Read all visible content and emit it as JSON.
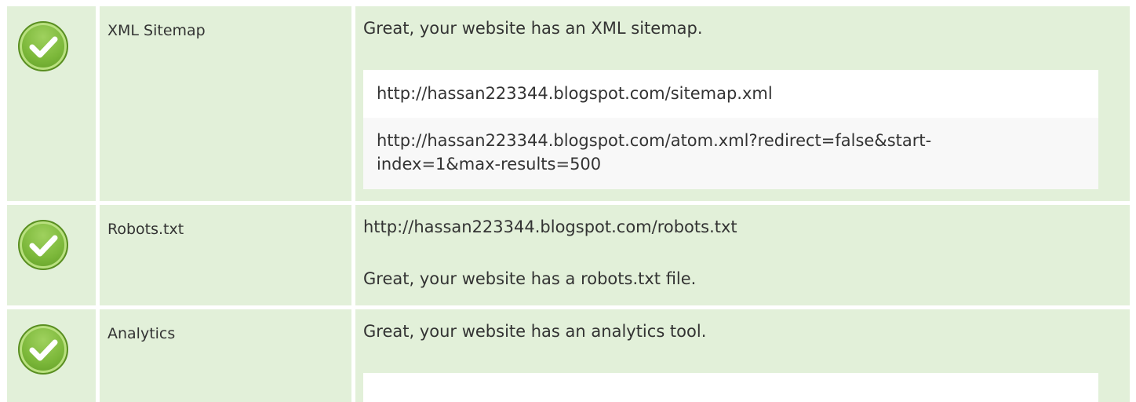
{
  "rows": [
    {
      "label": "XML Sitemap",
      "status_icon": "check-circle-icon",
      "message": "Great, your website has an XML sitemap.",
      "urls": [
        "http://hassan223344.blogspot.com/sitemap.xml",
        "http://hassan223344.blogspot.com/atom.xml?redirect=false&start-",
        "index=1&max-results=500"
      ]
    },
    {
      "label": "Robots.txt",
      "status_icon": "check-circle-icon",
      "url": "http://hassan223344.blogspot.com/robots.txt",
      "message": "Great, your website has a robots.txt file."
    },
    {
      "label": "Analytics",
      "status_icon": "check-circle-icon",
      "message": "Great, your website has an analytics tool."
    }
  ],
  "colors": {
    "row_bg": "#e2f0d9",
    "check_green": "#7cb83a",
    "text": "#333333"
  }
}
